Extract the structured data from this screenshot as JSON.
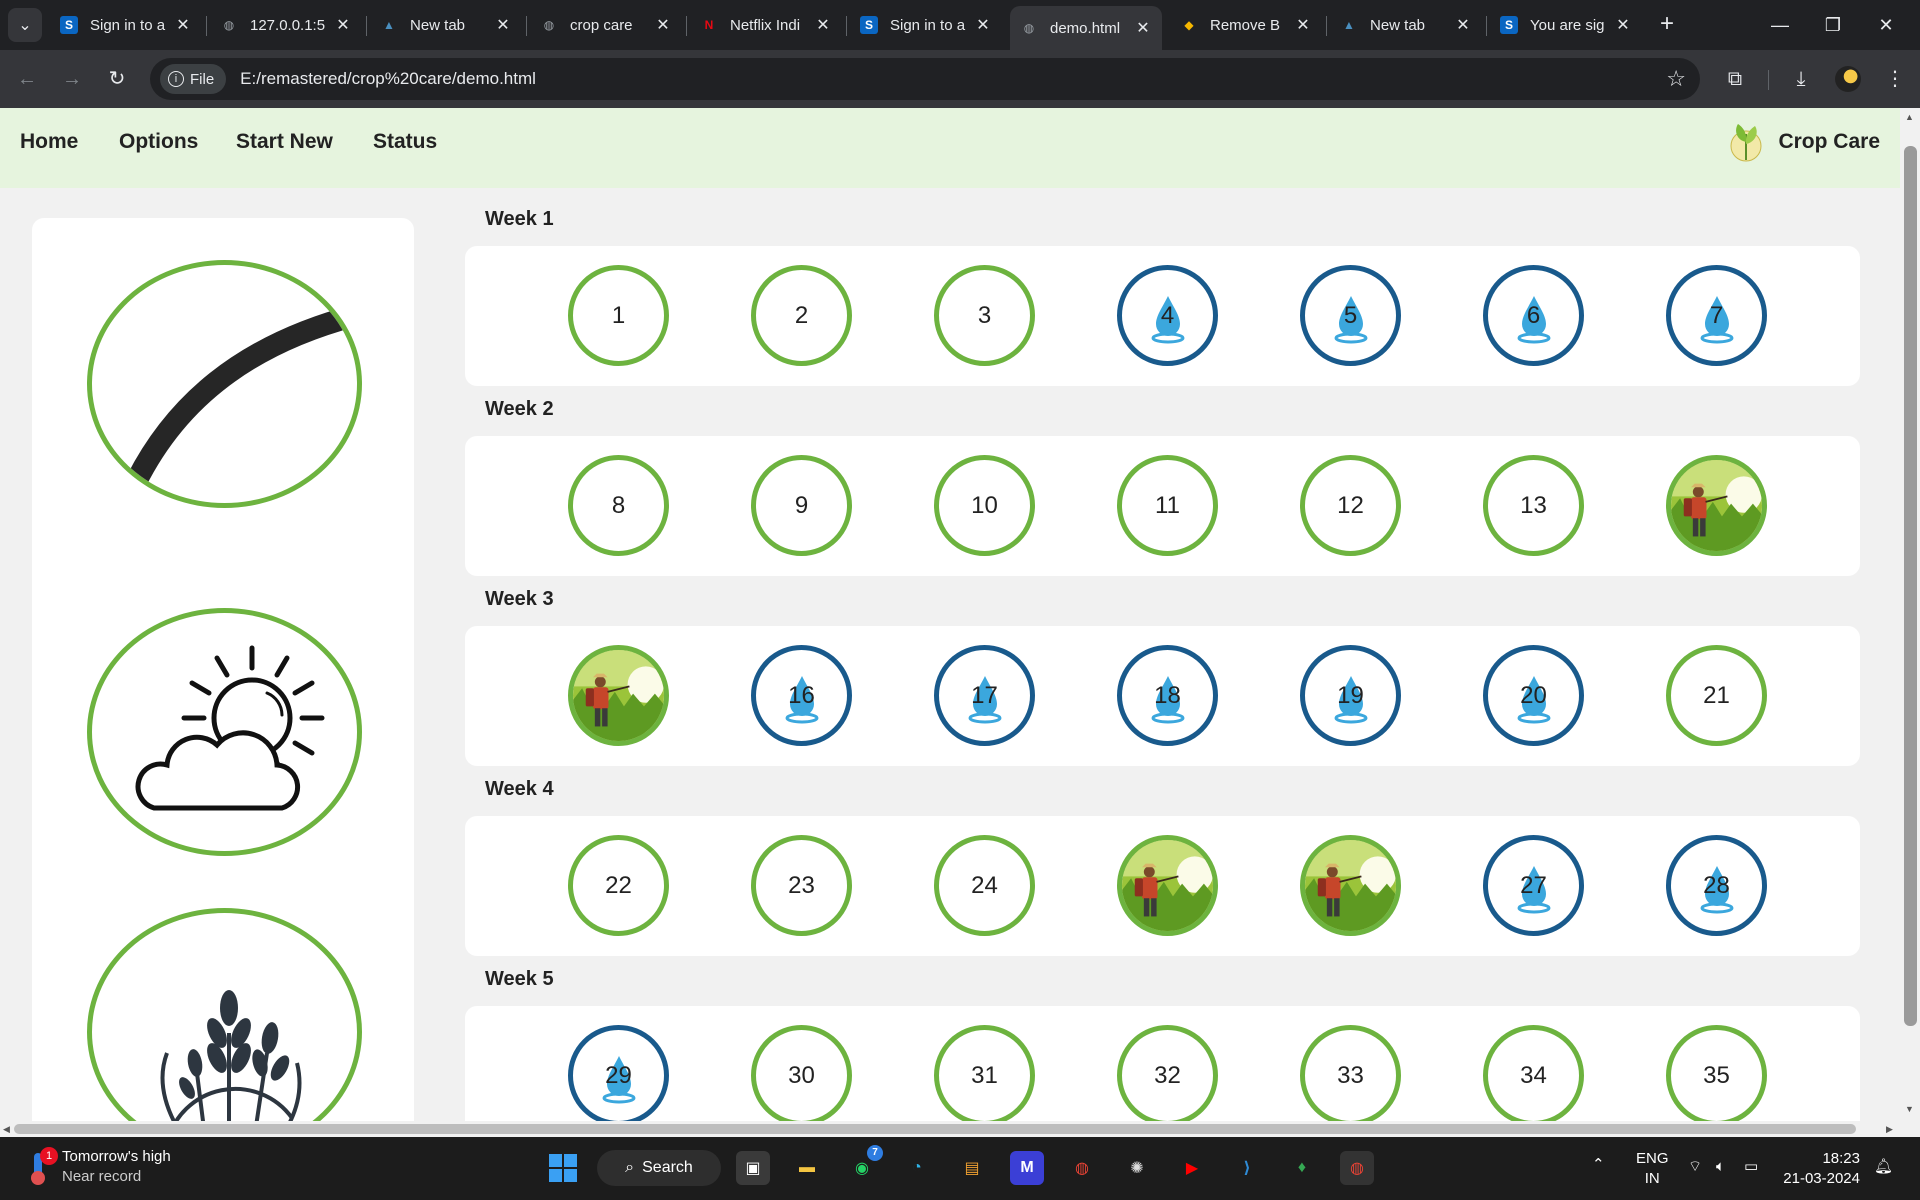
{
  "browser": {
    "tabs": [
      {
        "title": "Sign in to a",
        "favicon": "s-icon",
        "color": "#0a66c2",
        "letter": "S",
        "active": false
      },
      {
        "title": "127.0.0.1:5",
        "favicon": "globe-icon",
        "color": "#9aa0a6",
        "letter": "◍",
        "active": false
      },
      {
        "title": "New tab",
        "favicon": "landscape-icon",
        "color": "#4a8fbf",
        "letter": "▲",
        "active": false
      },
      {
        "title": "crop care",
        "favicon": "globe-icon",
        "color": "#9aa0a6",
        "letter": "◍",
        "active": false
      },
      {
        "title": "Netflix Indi",
        "favicon": "netflix-icon",
        "color": "#e50914",
        "letter": "N",
        "active": false
      },
      {
        "title": "Sign in to a",
        "favicon": "s-icon",
        "color": "#0a66c2",
        "letter": "S",
        "active": false
      },
      {
        "title": "demo.html",
        "favicon": "globe-icon",
        "color": "#9aa0a6",
        "letter": "◍",
        "active": true
      },
      {
        "title": "Remove B",
        "favicon": "remove-bg-icon",
        "color": "#f5b700",
        "letter": "◆",
        "active": false
      },
      {
        "title": "New tab",
        "favicon": "landscape-icon",
        "color": "#4a8fbf",
        "letter": "▲",
        "active": false
      },
      {
        "title": "You are sig",
        "favicon": "s-icon",
        "color": "#0a66c2",
        "letter": "S",
        "active": false
      }
    ],
    "site_chip": "File",
    "url": "E:/remastered/crop%20care/demo.html"
  },
  "page": {
    "nav": [
      "Home",
      "Options",
      "Start New",
      "Status"
    ],
    "brand": "Crop Care",
    "side_icons": [
      "harvest-progress-icon",
      "weather-icon",
      "wheat-icon"
    ],
    "weeks": [
      {
        "label": "Week 1",
        "days": [
          {
            "n": "1",
            "type": "plain"
          },
          {
            "n": "2",
            "type": "plain"
          },
          {
            "n": "3",
            "type": "plain"
          },
          {
            "n": "4",
            "type": "water"
          },
          {
            "n": "5",
            "type": "water"
          },
          {
            "n": "6",
            "type": "water"
          },
          {
            "n": "7",
            "type": "water"
          }
        ]
      },
      {
        "label": "Week 2",
        "days": [
          {
            "n": "8",
            "type": "plain"
          },
          {
            "n": "9",
            "type": "plain"
          },
          {
            "n": "10",
            "type": "plain"
          },
          {
            "n": "11",
            "type": "plain"
          },
          {
            "n": "12",
            "type": "plain"
          },
          {
            "n": "13",
            "type": "plain"
          },
          {
            "n": "",
            "type": "spray"
          }
        ]
      },
      {
        "label": "Week 3",
        "days": [
          {
            "n": "",
            "type": "spray"
          },
          {
            "n": "16",
            "type": "water"
          },
          {
            "n": "17",
            "type": "water"
          },
          {
            "n": "18",
            "type": "water"
          },
          {
            "n": "19",
            "type": "water"
          },
          {
            "n": "20",
            "type": "water"
          },
          {
            "n": "21",
            "type": "plain"
          }
        ]
      },
      {
        "label": "Week 4",
        "days": [
          {
            "n": "22",
            "type": "plain"
          },
          {
            "n": "23",
            "type": "plain"
          },
          {
            "n": "24",
            "type": "plain"
          },
          {
            "n": "",
            "type": "spray"
          },
          {
            "n": "",
            "type": "spray"
          },
          {
            "n": "27",
            "type": "water"
          },
          {
            "n": "28",
            "type": "water"
          }
        ]
      },
      {
        "label": "Week 5",
        "days": [
          {
            "n": "29",
            "type": "water"
          },
          {
            "n": "30",
            "type": "plain"
          },
          {
            "n": "31",
            "type": "plain"
          },
          {
            "n": "32",
            "type": "plain"
          },
          {
            "n": "33",
            "type": "plain"
          },
          {
            "n": "34",
            "type": "plain"
          },
          {
            "n": "35",
            "type": "plain"
          }
        ]
      }
    ],
    "colors": {
      "green": "#6db33f",
      "blue": "#195a8c",
      "navbar": "#e6f4de"
    }
  },
  "taskbar": {
    "weather_title": "Tomorrow's high",
    "weather_sub": "Near record",
    "weather_badge": "1",
    "search": "Search",
    "whatsapp_badge": "7",
    "lang_top": "ENG",
    "lang_bottom": "IN",
    "time": "18:23",
    "date": "21-03-2024"
  }
}
